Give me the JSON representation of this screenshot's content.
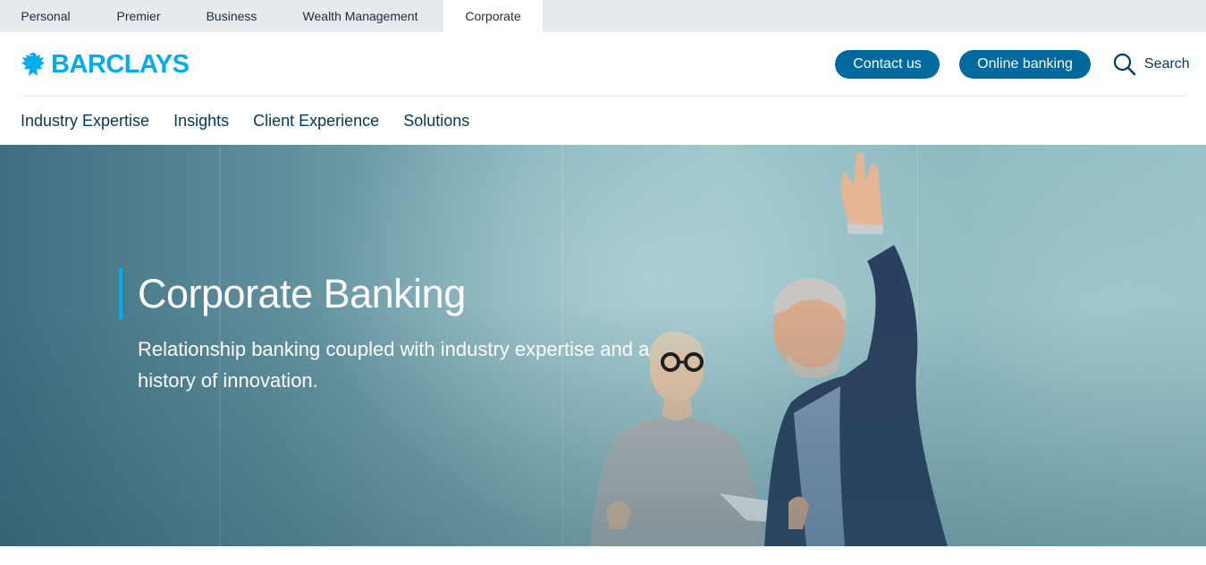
{
  "segments": [
    {
      "label": "Personal"
    },
    {
      "label": "Premier"
    },
    {
      "label": "Business"
    },
    {
      "label": "Wealth Management"
    },
    {
      "label": "Corporate",
      "active": true
    }
  ],
  "header": {
    "logo_text": "BARCLAYS",
    "contact_label": "Contact us",
    "online_label": "Online banking",
    "search_label": "Search"
  },
  "subnav": [
    {
      "label": "Industry Expertise"
    },
    {
      "label": "Insights"
    },
    {
      "label": "Client Experience"
    },
    {
      "label": "Solutions"
    }
  ],
  "hero": {
    "title": "Corporate Banking",
    "subtitle": "Relationship banking coupled with industry expertise and a history of innovation."
  },
  "colors": {
    "brand_cyan": "#00aeef",
    "button_blue": "#006a9e",
    "navy_text": "#00395d",
    "segbar_bg": "#e6eaee"
  }
}
